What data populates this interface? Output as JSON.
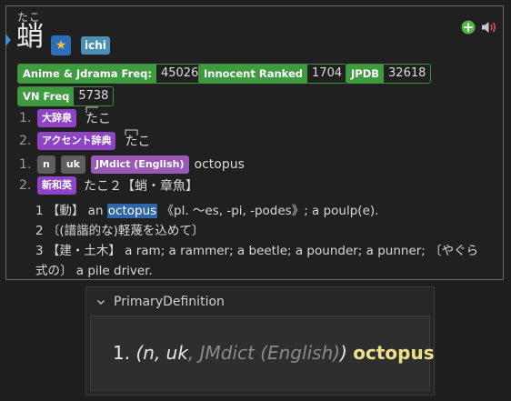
{
  "entry": {
    "reading": "たこ",
    "kanji": "蛸",
    "tags": {
      "star": "★",
      "ichi": "ichi"
    }
  },
  "frequencies": [
    {
      "name": "Anime & Jdrama Freq:",
      "value": "45026"
    },
    {
      "name": "Innocent Ranked",
      "value": "1704"
    },
    {
      "name": "JPDB",
      "value": "32618"
    },
    {
      "name": "VN Freq",
      "value": "5738"
    }
  ],
  "pitch": [
    {
      "num": "1.",
      "dict": "大辞泉",
      "reading": "たこ"
    },
    {
      "num": "2.",
      "dict": "アクセント辞典",
      "reading": "たこ"
    }
  ],
  "definitions": [
    {
      "num": "1.",
      "tags": [
        "n",
        "uk"
      ],
      "dict": "JMdict (English)",
      "gloss": "octopus"
    },
    {
      "num": "2.",
      "dict": "新和英",
      "head": "たこ２【蛸・章魚】",
      "lines": {
        "l1_pre": "1 【動】 an ",
        "l1_hl": "octopus",
        "l1_post": " 《pl. 〜es, -pi, -podes》; a poulp(e).",
        "l2": "2 〔(譜諧的な)軽蔑を込めて〕",
        "l3a": "3 【建・土木】 a ram; a rammer; a beetle; a pounder; a punner; 〔やぐら",
        "l3b": "式の〕 a pile driver."
      }
    }
  ],
  "panel": {
    "title": "PrimaryDefinition",
    "num": "1.",
    "open": "(",
    "tags": "n, uk",
    "sep": ", ",
    "dict": "JMdict (English)",
    "close": ")",
    "gloss": "octopus"
  },
  "colors": {
    "freq_green": "#3f9b3f",
    "dict_purple": "#8e44c4",
    "highlight_blue": "#2f66a8",
    "gloss_gold": "#f1e08a"
  },
  "icons": [
    "plus-circle-icon",
    "speaker-icon",
    "chevron-down-icon",
    "star-icon"
  ]
}
